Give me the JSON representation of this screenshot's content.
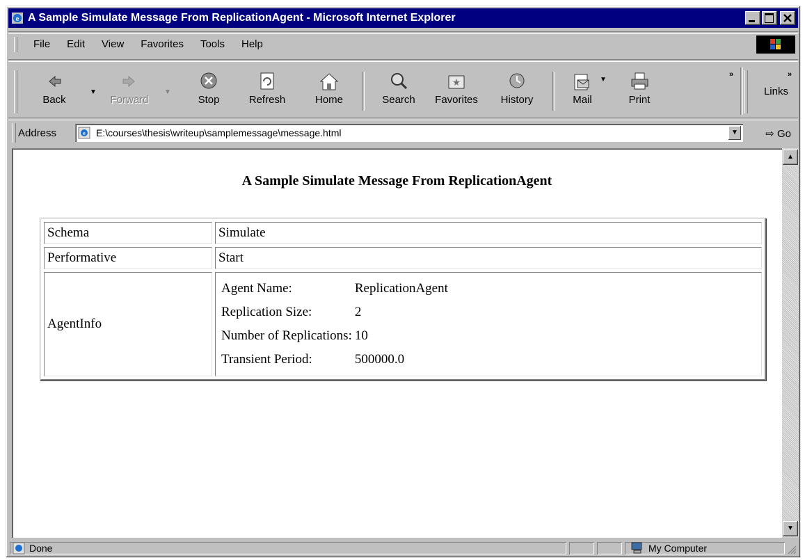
{
  "window": {
    "title": "A Sample Simulate Message From ReplicationAgent - Microsoft Internet Explorer"
  },
  "menu": [
    "File",
    "Edit",
    "View",
    "Favorites",
    "Tools",
    "Help"
  ],
  "toolbar": {
    "buttons": [
      {
        "label": "Back",
        "icon": "back-arrow-icon",
        "enabled": true
      },
      {
        "label": "Forward",
        "icon": "forward-arrow-icon",
        "enabled": false
      },
      {
        "label": "Stop",
        "icon": "stop-icon",
        "enabled": true
      },
      {
        "label": "Refresh",
        "icon": "refresh-icon",
        "enabled": true
      },
      {
        "label": "Home",
        "icon": "home-icon",
        "enabled": true
      },
      {
        "label": "Search",
        "icon": "search-icon",
        "enabled": true
      },
      {
        "label": "Favorites",
        "icon": "favorites-icon",
        "enabled": true
      },
      {
        "label": "History",
        "icon": "history-icon",
        "enabled": true
      },
      {
        "label": "Mail",
        "icon": "mail-icon",
        "enabled": true
      },
      {
        "label": "Print",
        "icon": "print-icon",
        "enabled": true
      }
    ],
    "links_label": "Links"
  },
  "address": {
    "label": "Address",
    "url": "E:\\courses\\thesis\\writeup\\samplemessage\\message.html",
    "go_label": "Go"
  },
  "page": {
    "heading": "A Sample Simulate Message From ReplicationAgent",
    "rows": [
      {
        "key": "Schema",
        "value": "Simulate"
      },
      {
        "key": "Performative",
        "value": "Start"
      }
    ],
    "agentinfo": {
      "key": "AgentInfo",
      "fields": [
        {
          "label": "Agent Name:",
          "value": "ReplicationAgent"
        },
        {
          "label": "Replication Size:",
          "value": "2"
        },
        {
          "label": "Number of Replications:",
          "value": "10"
        },
        {
          "label": "Transient Period:",
          "value": "500000.0"
        }
      ]
    }
  },
  "status": {
    "text": "Done",
    "zone": "My Computer"
  },
  "colors": {
    "titlebar": "#000080",
    "chrome": "#c0c0c0"
  }
}
